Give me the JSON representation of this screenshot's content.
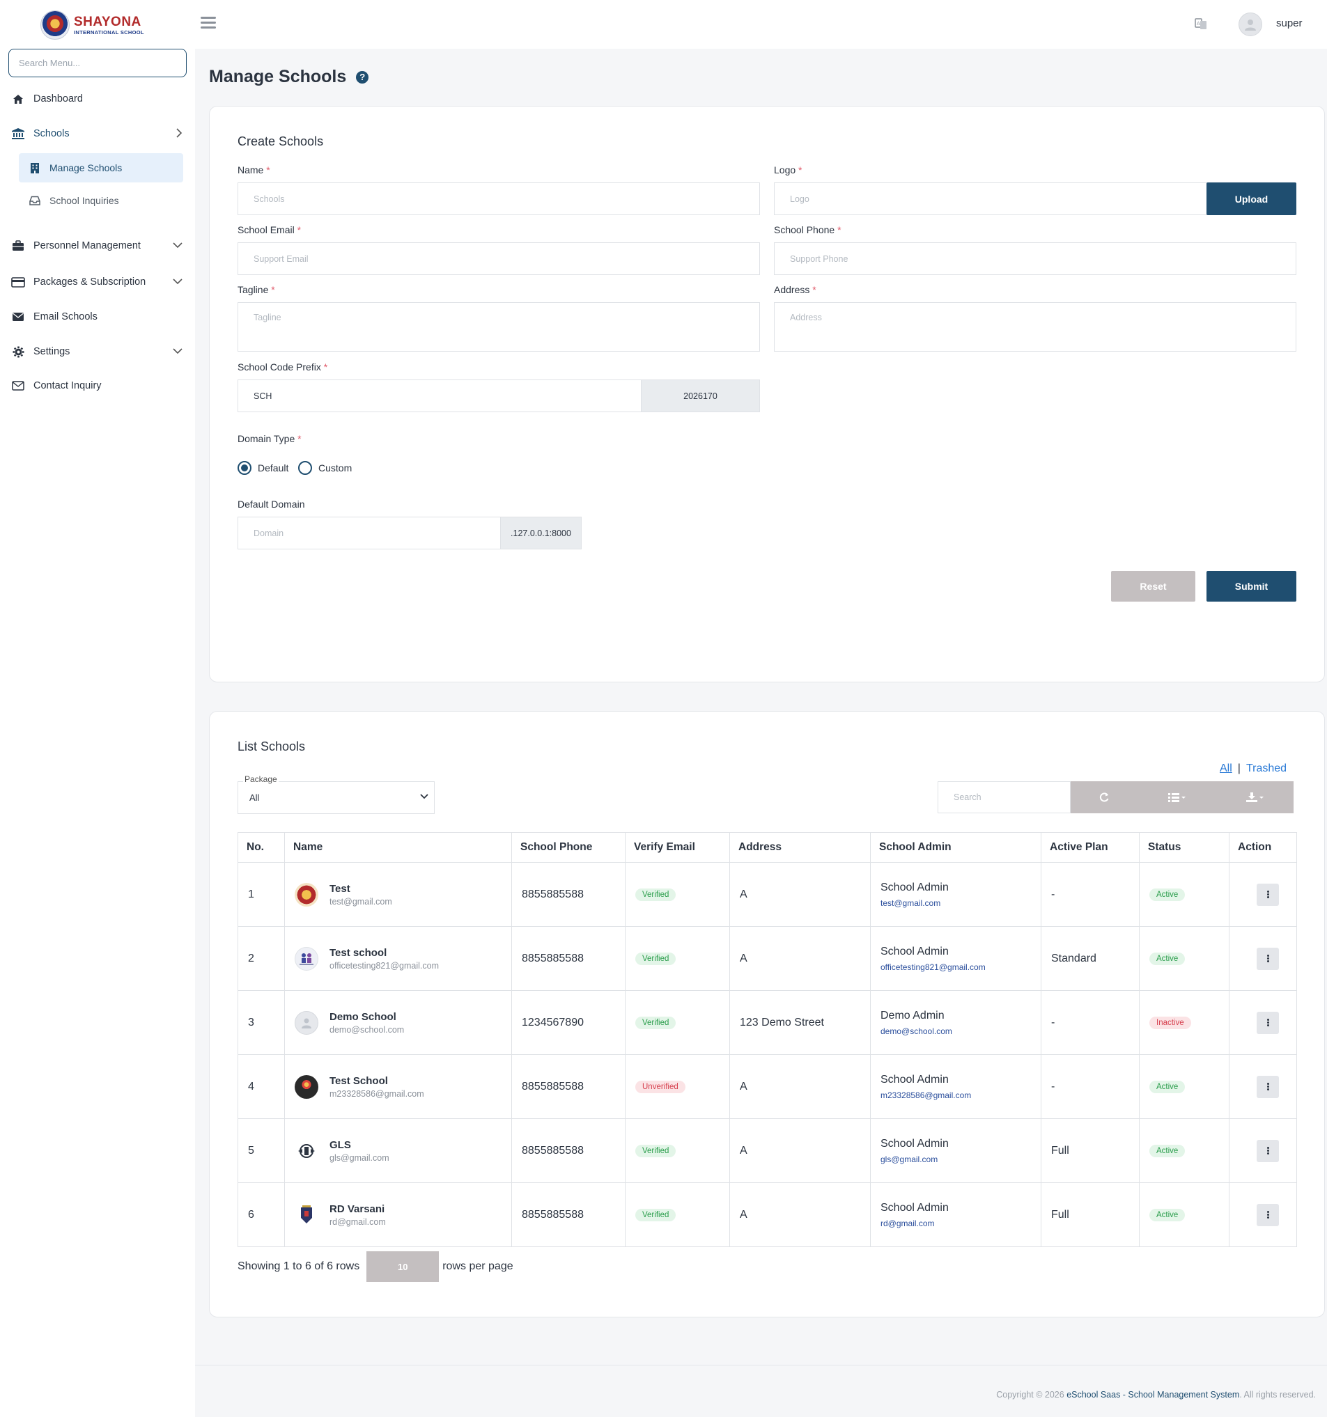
{
  "sidebar": {
    "logo_title": "SHAYONA",
    "logo_subtitle": "INTERNATIONAL SCHOOL",
    "search_placeholder": "Search Menu...",
    "items": [
      {
        "label": "Dashboard",
        "icon": "home-icon"
      },
      {
        "label": "Schools",
        "icon": "bank-icon",
        "expanded": true
      },
      {
        "label": "Manage Schools",
        "icon": "building-icon",
        "active": true
      },
      {
        "label": "School Inquiries",
        "icon": "inbox-icon"
      },
      {
        "label": "Personnel Management",
        "icon": "briefcase-icon"
      },
      {
        "label": "Packages & Subscription",
        "icon": "credit-card-icon"
      },
      {
        "label": "Email Schools",
        "icon": "envelope-icon"
      },
      {
        "label": "Settings",
        "icon": "gear-icon"
      },
      {
        "label": "Contact Inquiry",
        "icon": "envelope-outline-icon"
      }
    ]
  },
  "topbar": {
    "username": "super"
  },
  "page": {
    "title": "Manage Schools",
    "help": "?"
  },
  "create": {
    "title": "Create Schools",
    "name_label": "Name",
    "name_placeholder": "Schools",
    "logo_label": "Logo",
    "logo_placeholder": "Logo",
    "upload_label": "Upload",
    "email_label": "School Email",
    "email_placeholder": "Support Email",
    "phone_label": "School Phone",
    "phone_placeholder": "Support Phone",
    "tagline_label": "Tagline",
    "tagline_placeholder": "Tagline",
    "address_label": "Address",
    "address_placeholder": "Address",
    "code_label": "School Code Prefix",
    "code_value": "SCH",
    "code_suffix": "2026170",
    "domain_type_label": "Domain Type",
    "domain_default": "Default",
    "domain_custom": "Custom",
    "domain_selected": "Default",
    "default_domain_label": "Default Domain",
    "domain_placeholder": "Domain",
    "domain_suffix": ".127.0.0.1:8000",
    "reset_label": "Reset",
    "submit_label": "Submit",
    "required_mark": "*"
  },
  "list": {
    "title": "List Schools",
    "filter_all": "All",
    "filter_sep": "|",
    "filter_trashed": "Trashed",
    "package_label": "Package",
    "package_value": "All",
    "search_placeholder": "Search",
    "columns": [
      "No.",
      "Name",
      "School Phone",
      "Verify Email",
      "Address",
      "School Admin",
      "Active Plan",
      "Status",
      "Action"
    ],
    "rows": [
      {
        "no": "1",
        "name": "Test",
        "email": "test@gmail.com",
        "phone": "8855885588",
        "verify": "Verified",
        "address": "A",
        "admin": "School Admin",
        "admin_email": "test@gmail.com",
        "plan": "-",
        "status": "Active"
      },
      {
        "no": "2",
        "name": "Test school",
        "email": "officetesting821@gmail.com",
        "phone": "8855885588",
        "verify": "Verified",
        "address": "A",
        "admin": "School Admin",
        "admin_email": "officetesting821@gmail.com",
        "plan": "Standard",
        "status": "Active"
      },
      {
        "no": "3",
        "name": "Demo School",
        "email": "demo@school.com",
        "phone": "1234567890",
        "verify": "Verified",
        "address": "123 Demo Street",
        "admin": "Demo Admin",
        "admin_email": "demo@school.com",
        "plan": "-",
        "status": "Inactive"
      },
      {
        "no": "4",
        "name": "Test School",
        "email": "m23328586@gmail.com",
        "phone": "8855885588",
        "verify": "Unverified",
        "address": "A",
        "admin": "School Admin",
        "admin_email": "m23328586@gmail.com",
        "plan": "-",
        "status": "Active"
      },
      {
        "no": "5",
        "name": "GLS",
        "email": "gls@gmail.com",
        "phone": "8855885588",
        "verify": "Verified",
        "address": "A",
        "admin": "School Admin",
        "admin_email": "gls@gmail.com",
        "plan": "Full",
        "status": "Active"
      },
      {
        "no": "6",
        "name": "RD Varsani",
        "email": "rd@gmail.com",
        "phone": "8855885588",
        "verify": "Verified",
        "address": "A",
        "admin": "School Admin",
        "admin_email": "rd@gmail.com",
        "plan": "Full",
        "status": "Active"
      }
    ],
    "showing_text": "Showing 1 to 6 of 6 rows",
    "page_size": "10",
    "rows_per_page": "rows per page"
  },
  "footer": {
    "prefix": "Copyright © 2026 ",
    "brand": "eSchool Saas - School Management System",
    "suffix": ". All rights reserved."
  },
  "colors": {
    "primary": "#1f4e70",
    "muted_button": "#c4bfc0",
    "verified": "#2a9d4b",
    "unverified": "#d6404f",
    "link": "#2a7ad6"
  }
}
